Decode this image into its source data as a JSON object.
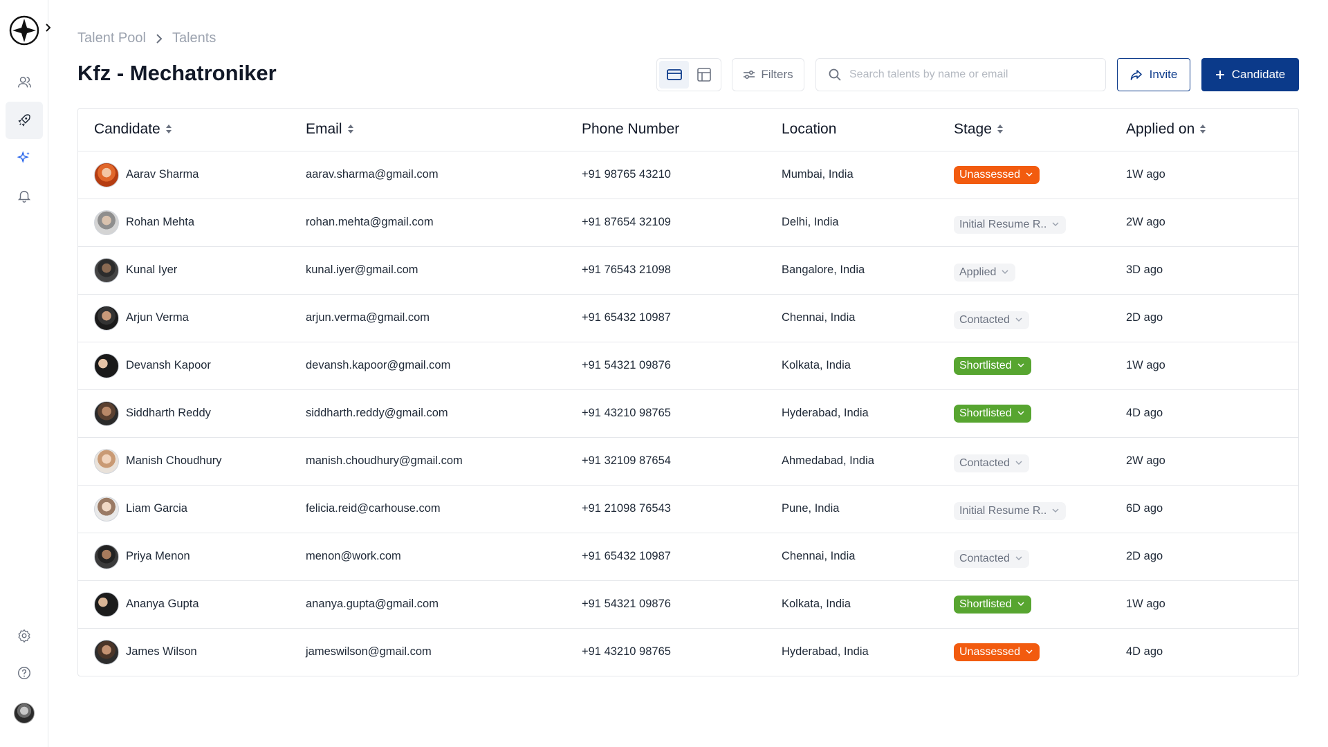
{
  "breadcrumb": {
    "parent": "Talent Pool",
    "current": "Talents"
  },
  "page": {
    "title": "Kfz - Mechatroniker"
  },
  "toolbar": {
    "filters_label": "Filters",
    "search_placeholder": "Search talents by name or email",
    "search_value": "",
    "invite_label": "Invite",
    "candidate_label": "Candidate"
  },
  "table": {
    "headers": {
      "candidate": "Candidate",
      "email": "Email",
      "phone": "Phone Number",
      "location": "Location",
      "stage": "Stage",
      "applied": "Applied on"
    },
    "rows": [
      {
        "name": "Aarav Sharma",
        "email": "aarav.sharma@gmail.com",
        "phone": "+91 98765 43210",
        "location": "Mumbai, India",
        "stage": "Unassessed",
        "stage_color": "#f25b0f",
        "applied": "1W ago"
      },
      {
        "name": "Rohan Mehta",
        "email": "rohan.mehta@gmail.com",
        "phone": "+91 87654 32109",
        "location": "Delhi, India",
        "stage": "Initial Resume R..",
        "stage_color": "#f3f4f6",
        "applied": "2W ago"
      },
      {
        "name": "Kunal Iyer",
        "email": "kunal.iyer@gmail.com",
        "phone": "+91 76543 21098",
        "location": "Bangalore, India",
        "stage": "Applied",
        "stage_color": "#f3f4f6",
        "applied": "3D ago"
      },
      {
        "name": "Arjun Verma",
        "email": "arjun.verma@gmail.com",
        "phone": "+91 65432 10987",
        "location": "Chennai, India",
        "stage": "Contacted",
        "stage_color": "#f3f4f6",
        "applied": "2D ago"
      },
      {
        "name": "Devansh Kapoor",
        "email": "devansh.kapoor@gmail.com",
        "phone": "+91 54321 09876",
        "location": "Kolkata, India",
        "stage": "Shortlisted",
        "stage_color": "#57a530",
        "applied": "1W ago"
      },
      {
        "name": "Siddharth Reddy",
        "email": "siddharth.reddy@gmail.com",
        "phone": "+91 43210 98765",
        "location": "Hyderabad, India",
        "stage": "Shortlisted",
        "stage_color": "#57a530",
        "applied": "4D ago"
      },
      {
        "name": "Manish Choudhury",
        "email": "manish.choudhury@gmail.com",
        "phone": "+91 32109 87654",
        "location": "Ahmedabad, India",
        "stage": "Contacted",
        "stage_color": "#f3f4f6",
        "applied": "2W ago"
      },
      {
        "name": "Liam Garcia",
        "email": "felicia.reid@carhouse.com",
        "phone": "+91 21098 76543",
        "location": "Pune, India",
        "stage": "Initial Resume R..",
        "stage_color": "#f3f4f6",
        "applied": "6D ago"
      },
      {
        "name": "Priya Menon",
        "email": "menon@work.com",
        "phone": "+91 65432 10987",
        "location": "Chennai, India",
        "stage": "Contacted",
        "stage_color": "#f3f4f6",
        "applied": "2D ago"
      },
      {
        "name": "Ananya Gupta",
        "email": "ananya.gupta@gmail.com",
        "phone": "+91 54321 09876",
        "location": "Kolkata, India",
        "stage": "Shortlisted",
        "stage_color": "#57a530",
        "applied": "1W ago"
      },
      {
        "name": "James Wilson",
        "email": "jameswilson@gmail.com",
        "phone": "+91 43210 98765",
        "location": "Hyderabad, India",
        "stage": "Unassessed",
        "stage_color": "#f25b0f",
        "applied": "4D ago"
      }
    ]
  },
  "colors": {
    "primary": "#0b3a8a",
    "accent_icon": "#2563eb"
  },
  "icons": [
    "logo-icon",
    "users-icon",
    "rocket-icon",
    "sparkle-icon",
    "bell-icon",
    "settings-icon",
    "help-icon",
    "card-view-icon",
    "table-view-icon",
    "filter-icon",
    "search-icon",
    "share-icon",
    "plus-icon",
    "sort-icon",
    "chevron-down-icon"
  ]
}
